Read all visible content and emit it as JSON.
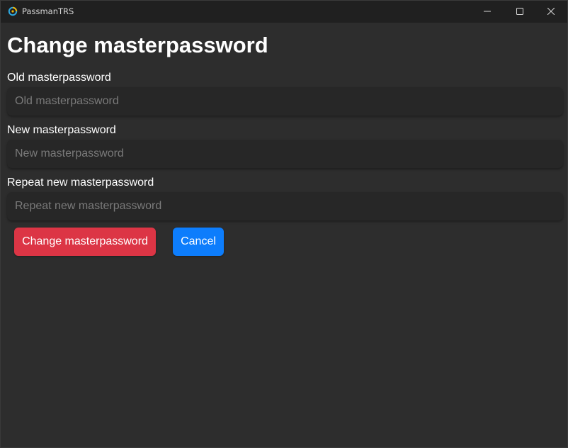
{
  "window": {
    "title": "PassmanTRS",
    "app_icon": "passman-logo-icon",
    "controls": {
      "minimize_icon": "minimize-icon",
      "maximize_icon": "maximize-icon",
      "close_icon": "close-icon"
    }
  },
  "page": {
    "heading": "Change masterpassword"
  },
  "form": {
    "old_password": {
      "label": "Old masterpassword",
      "placeholder": "Old masterpassword",
      "value": ""
    },
    "new_password": {
      "label": "New masterpassword",
      "placeholder": "New masterpassword",
      "value": ""
    },
    "repeat_password": {
      "label": "Repeat new masterpassword",
      "placeholder": "Repeat new masterpassword",
      "value": ""
    }
  },
  "actions": {
    "submit_label": "Change masterpassword",
    "cancel_label": "Cancel"
  },
  "colors": {
    "background": "#2d2d2d",
    "titlebar": "#202020",
    "input_background": "#272727",
    "danger": "#dc3545",
    "primary": "#0d7dfc"
  }
}
